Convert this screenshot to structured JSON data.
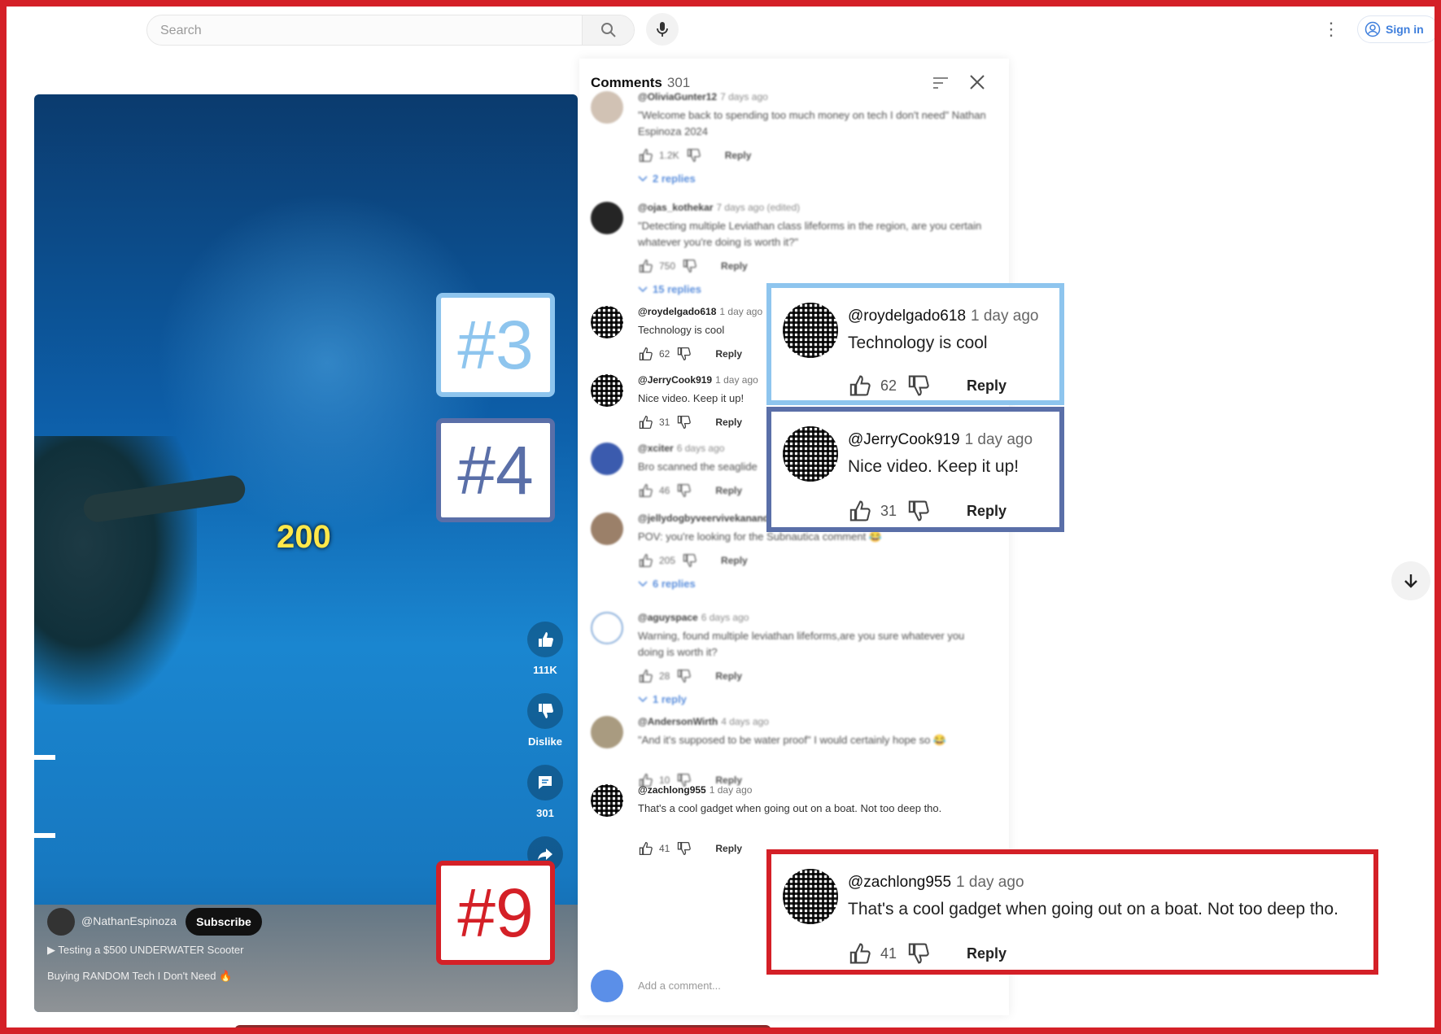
{
  "search": {
    "placeholder": "Search"
  },
  "header": {
    "signin_label": "Sign in"
  },
  "video": {
    "counter": "200",
    "likes": "111K",
    "dislike_label": "Dislike",
    "comments_count": "301",
    "channel": "@NathanEspinoza",
    "subscribe_label": "Subscribe",
    "title": "Testing a $500 UNDERWATER Scooter",
    "playlist": "Buying RANDOM Tech I Don't Need 🔥"
  },
  "comments_panel": {
    "title": "Comments",
    "count": "301",
    "add_placeholder": "Add a comment...",
    "comments": [
      {
        "user": "@OliviaGunter12",
        "time": "7 days ago",
        "text": "\"Welcome back to spending too much money on tech I don't need\" Nathan Espinoza 2024",
        "likes": "1.2K",
        "reply": "Reply",
        "replies": "2 replies"
      },
      {
        "user": "@ojas_kothekar",
        "time": "7 days ago (edited)",
        "text": "\"Detecting multiple Leviathan class lifeforms in the region, are you certain whatever you're doing is worth it?\"",
        "likes": "750",
        "reply": "Reply",
        "replies": "15 replies"
      },
      {
        "user": "@roydelgado618",
        "time": "1 day ago",
        "text": "Technology is cool",
        "likes": "62",
        "reply": "Reply"
      },
      {
        "user": "@JerryCook919",
        "time": "1 day ago",
        "text": "Nice video. Keep it up!",
        "likes": "31",
        "reply": "Reply"
      },
      {
        "user": "@xciter",
        "time": "6 days ago",
        "text": "Bro scanned the seaglide",
        "likes": "46",
        "reply": "Reply"
      },
      {
        "user": "@jellydogbyveervivekanandad7673",
        "time": "6 days ago",
        "text": "POV: you're looking for the Subnautica comment 😂",
        "likes": "205",
        "reply": "Reply",
        "replies": "6 replies"
      },
      {
        "user": "@aguyspace",
        "time": "6 days ago",
        "text": "Warning, found multiple leviathan lifeforms,are you sure whatever you doing is worth it?",
        "likes": "28",
        "reply": "Reply",
        "replies": "1 reply"
      },
      {
        "user": "@AndersonWirth",
        "time": "4 days ago",
        "text": "\"And it's supposed to be water proof\" I would certainly hope so 😂",
        "likes": "10",
        "reply": "Reply"
      },
      {
        "user": "@zachlong955",
        "time": "1 day ago",
        "text": "That's a cool gadget when going out on a boat. Not too deep tho.",
        "likes": "41",
        "reply": "Reply"
      }
    ]
  },
  "callouts": [
    {
      "label": "#3",
      "color": "#8ec5ee",
      "user": "@roydelgado618",
      "time": "1 day ago",
      "text": "Technology is cool",
      "likes": "62",
      "reply": "Reply"
    },
    {
      "label": "#4",
      "color": "#5a6fa8",
      "user": "@JerryCook919",
      "time": "1 day ago",
      "text": "Nice video. Keep it up!",
      "likes": "31",
      "reply": "Reply"
    },
    {
      "label": "#9",
      "color": "#d42027",
      "user": "@zachlong955",
      "time": "1 day ago",
      "text": "That's a cool gadget when going out on a boat. Not too deep tho.",
      "likes": "41",
      "reply": "Reply"
    }
  ],
  "colors": {
    "frame": "#d42027",
    "link_blue": "#3e7bd6",
    "counter_yellow": "#ffe84a"
  },
  "icons": [
    "search-icon",
    "mic-icon",
    "more-vert-icon",
    "account-icon",
    "like-icon",
    "dislike-icon",
    "comment-icon",
    "share-icon",
    "sort-icon",
    "close-icon",
    "chevron-down-icon",
    "arrow-down-icon"
  ]
}
